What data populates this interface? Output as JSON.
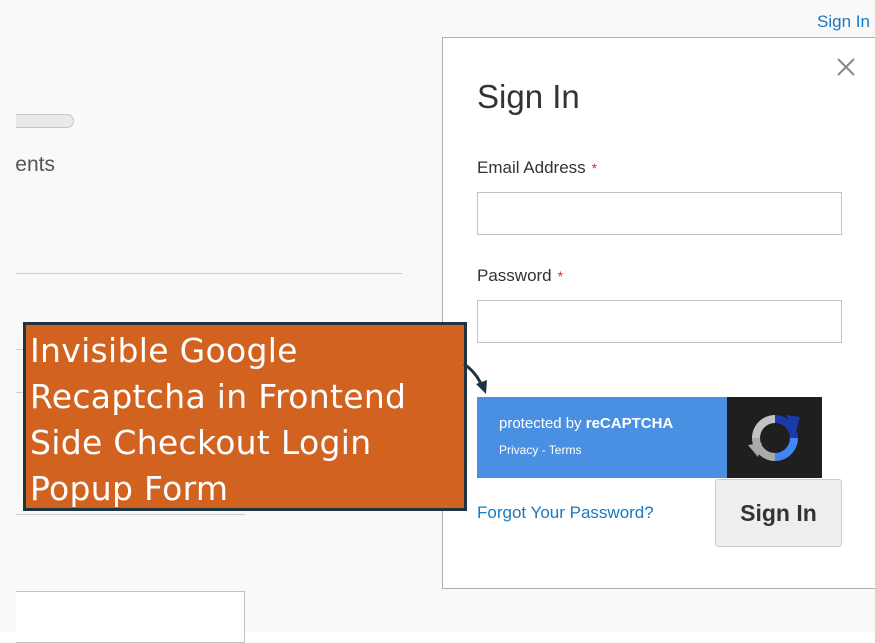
{
  "header": {
    "signin_link": "Sign In"
  },
  "background": {
    "partial_text": "ents"
  },
  "modal": {
    "title": "Sign In",
    "close_icon": "close-icon",
    "email": {
      "label": "Email Address",
      "required_mark": "*",
      "value": "",
      "placeholder": ""
    },
    "password": {
      "label": "Password",
      "required_mark": "*",
      "value": "",
      "placeholder": ""
    },
    "recaptcha": {
      "protected_by": "protected by",
      "brand": "reCAPTCHA",
      "privacy": "Privacy",
      "separator": " - ",
      "terms": "Terms",
      "logo_icon": "recaptcha-logo-icon"
    },
    "forgot_password": "Forgot Your Password?",
    "submit": "Sign In"
  },
  "annotation": {
    "lines": [
      "Invisible Google",
      "Recaptcha in Frontend",
      "Side Checkout Login",
      "Popup Form"
    ],
    "arrow_icon": "arrow-icon"
  },
  "colors": {
    "link": "#1979c3",
    "required": "#e02b27",
    "annotation_bg": "#d2621f",
    "annotation_border": "#1e3440",
    "recaptcha_blue": "#4a90e2",
    "recaptcha_dark": "#1f1f1f"
  }
}
